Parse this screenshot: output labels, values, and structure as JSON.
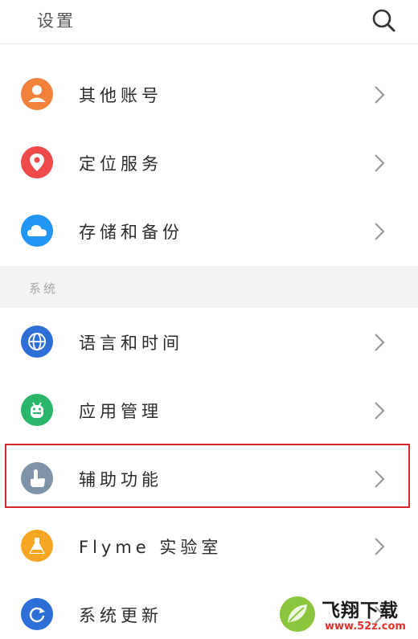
{
  "header": {
    "title": "设置"
  },
  "colors": {
    "accounts": "#f0803a",
    "location": "#ee4a4a",
    "storage": "#2196f3",
    "language": "#2d6fd6",
    "apps": "#2ab76a",
    "accessibility": "#7e93a8",
    "lab": "#f5a623",
    "update": "#2d6fd6",
    "highlight": "#d8262c"
  },
  "items": [
    {
      "label": "其他账号",
      "icon": "person-icon"
    },
    {
      "label": "定位服务",
      "icon": "location-pin-icon"
    },
    {
      "label": "存储和备份",
      "icon": "cloud-icon"
    }
  ],
  "section": {
    "title": "系统"
  },
  "system_items": [
    {
      "label": "语言和时间",
      "icon": "globe-icon"
    },
    {
      "label": "应用管理",
      "icon": "android-icon"
    },
    {
      "label": "辅助功能",
      "icon": "hand-pointer-icon"
    },
    {
      "label": "Flyme 实验室",
      "icon": "flask-icon"
    },
    {
      "label": "系统更新",
      "icon": "refresh-icon"
    }
  ],
  "watermark": {
    "brand": "飞翔下载",
    "url": "www.52z.com"
  }
}
